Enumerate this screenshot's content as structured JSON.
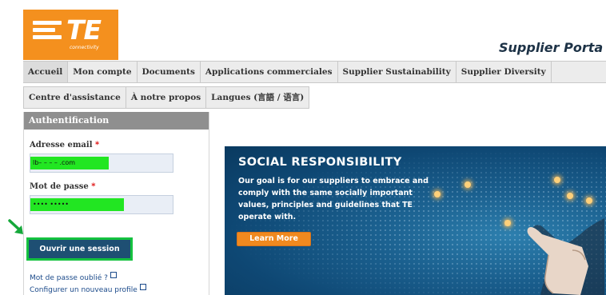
{
  "logo": {
    "brand": "TE",
    "tagline": "connectivity",
    "color": "#f4901e"
  },
  "portal_title": "Supplier Porta",
  "nav": {
    "row1": [
      "Accueil",
      "Mon compte",
      "Documents",
      "Applications commerciales",
      "Supplier Sustainability",
      "Supplier Diversity"
    ],
    "row2": [
      "Centre d'assistance",
      "À notre propos",
      "Langues (言語 / 语言)"
    ]
  },
  "auth": {
    "header": "Authentification",
    "email_label": "Adresse email",
    "email_value": "lb– – – – .com",
    "password_label": "Mot de passe",
    "password_value": "••••              •••••",
    "required_mark": "*",
    "login_button": "Ouvrir une session",
    "forgot_link": "Mot de passe oublié ?",
    "new_profile_link": "Configurer un nouveau profile"
  },
  "banner": {
    "title": "SOCIAL RESPONSIBILITY",
    "body": "Our goal is for our suppliers to embrace and comply with the same socially important values, principles and guidelines that TE operate with.",
    "button": "Learn More"
  },
  "colors": {
    "highlight_green": "#22e622",
    "button_blue": "#1e4f73",
    "banner_orange": "#f0891f",
    "auth_header_grey": "#8f8f8f"
  },
  "icons": [
    "external-link-icon",
    "green-arrow-icon"
  ]
}
